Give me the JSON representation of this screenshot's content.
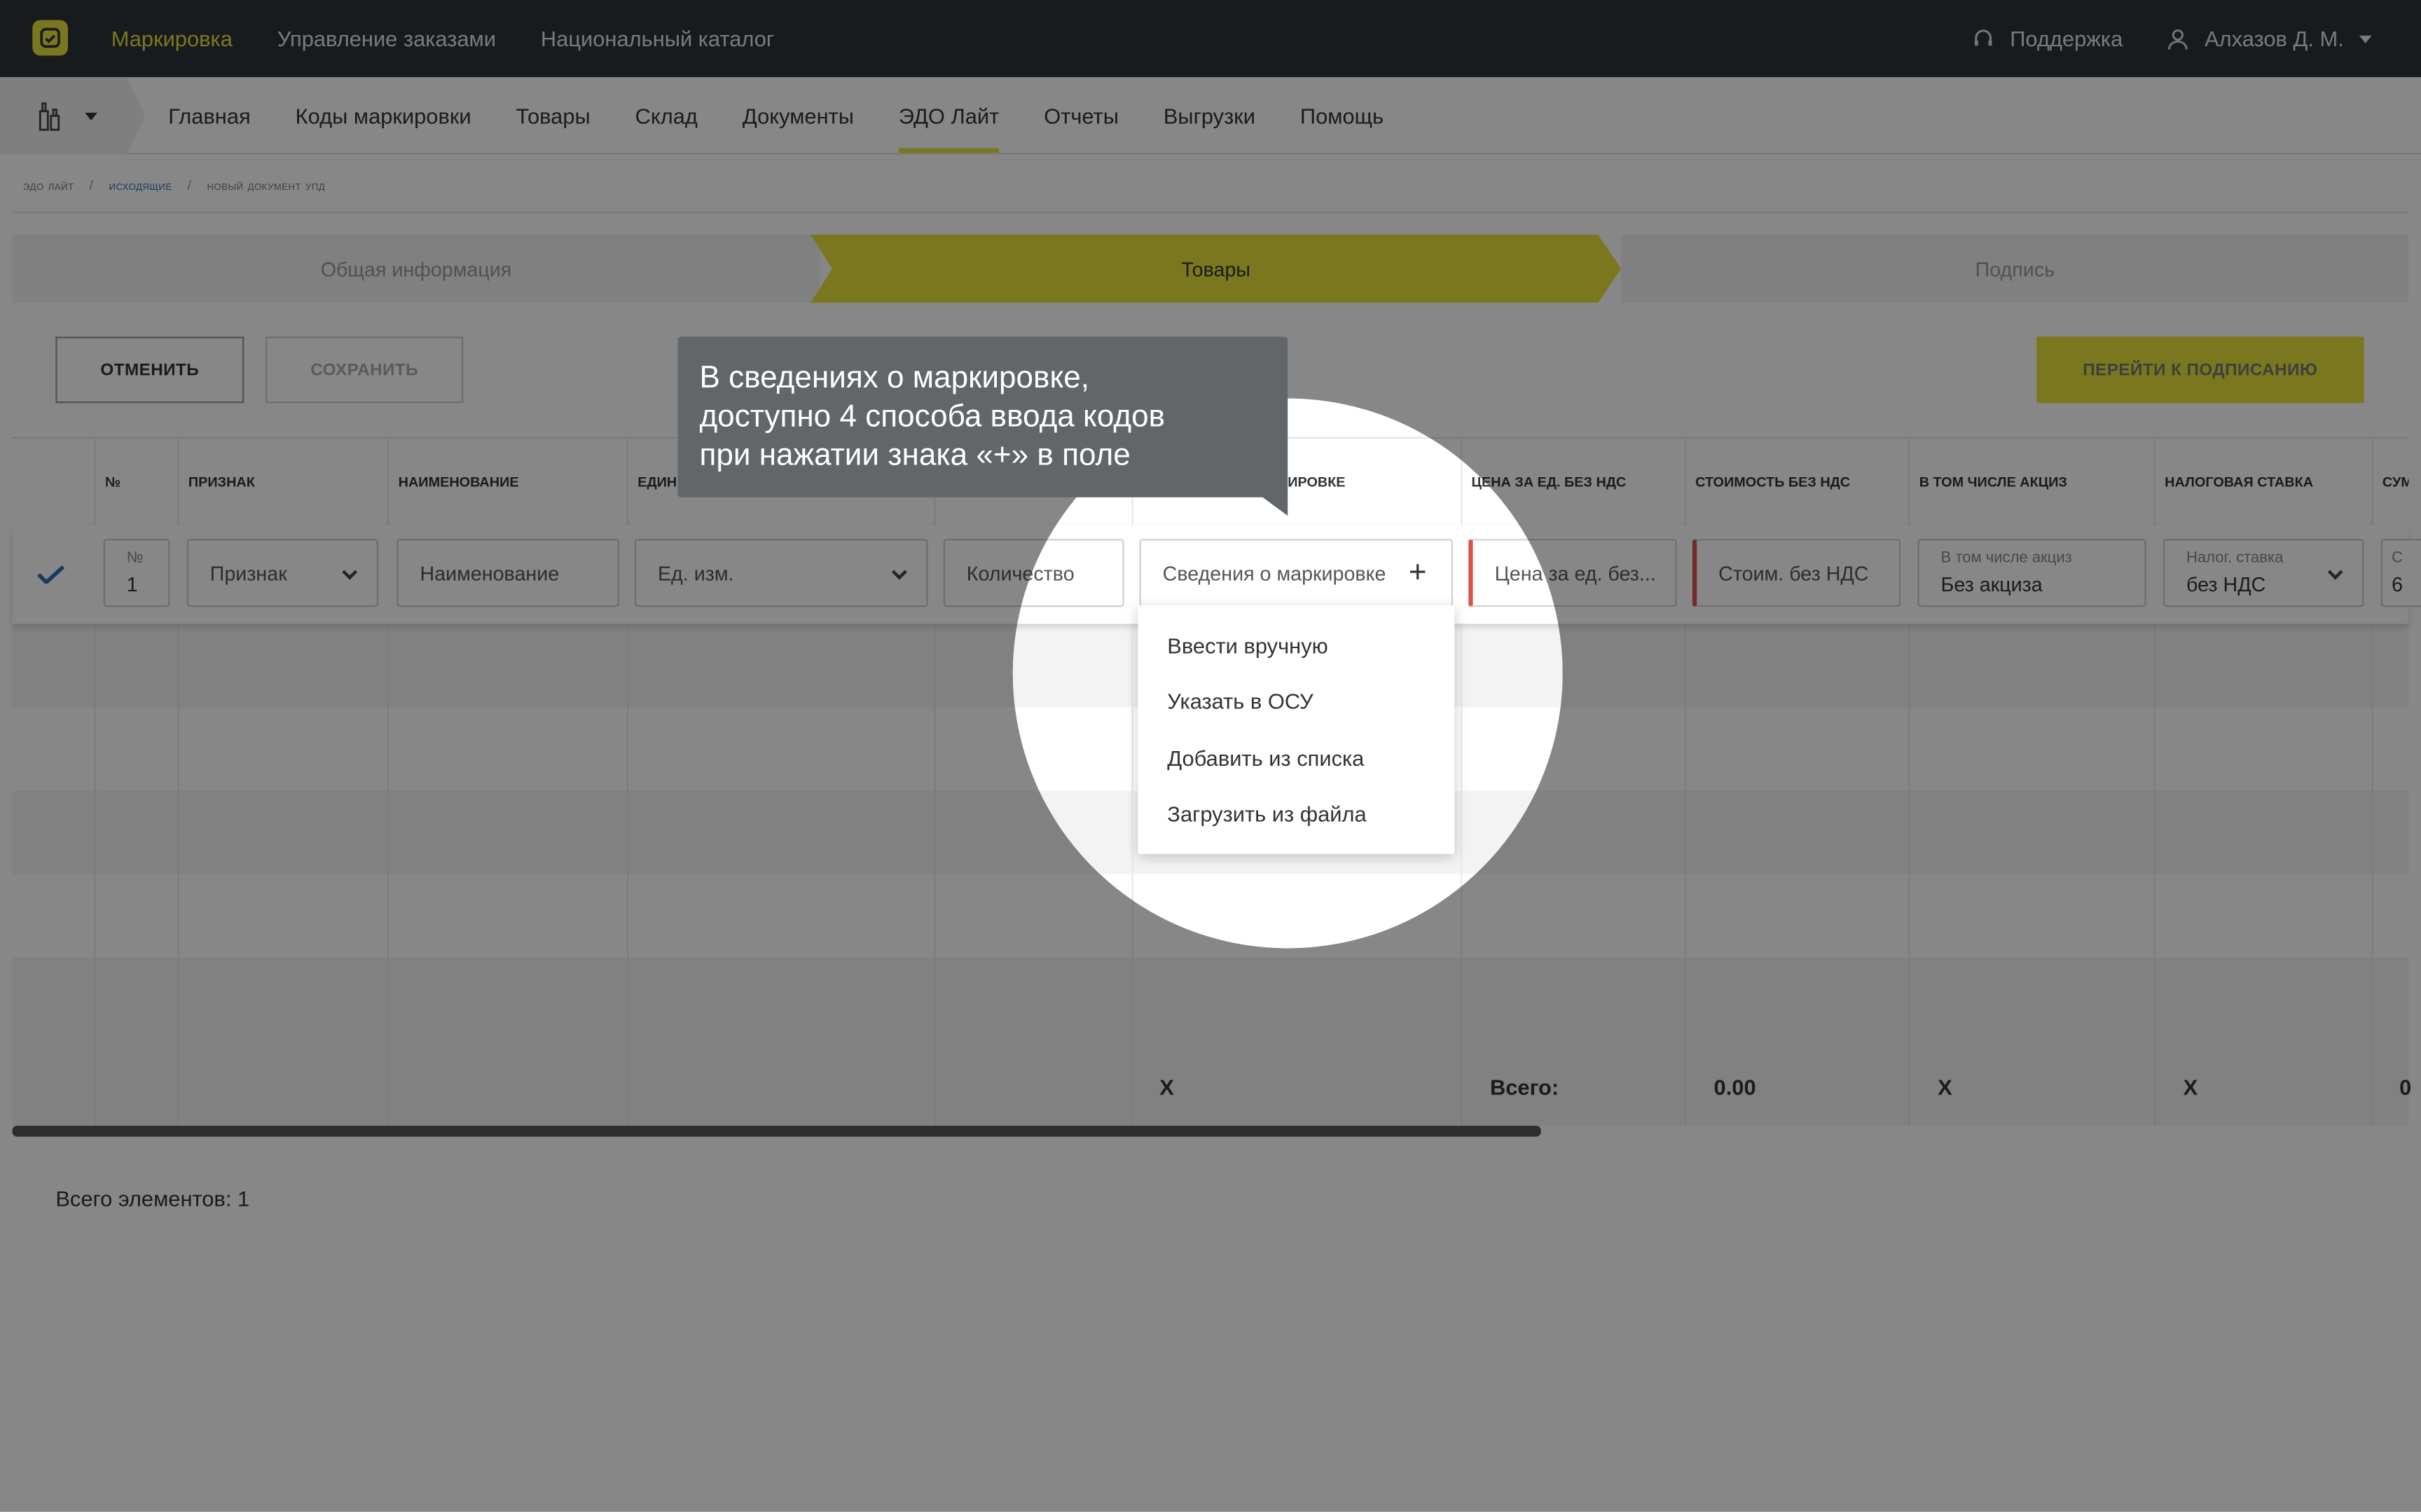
{
  "topbar": {
    "nav": [
      "Маркировка",
      "Управление заказами",
      "Национальный каталог"
    ],
    "support": "Поддержка",
    "user": "Алхазов Д. М."
  },
  "subnav": {
    "items": [
      "Главная",
      "Коды маркировки",
      "Товары",
      "Склад",
      "Документы",
      "ЭДО Лайт",
      "Отчеты",
      "Выгрузки",
      "Помощь"
    ],
    "active": "ЭДО Лайт"
  },
  "breadcrumb": {
    "items": [
      "эдо лайт",
      "исходящие",
      "новый документ упд"
    ],
    "separator": "/"
  },
  "steps": [
    "Общая информация",
    "Товары",
    "Подпись"
  ],
  "actions": {
    "cancel": "ОТМЕНИТЬ",
    "save": "СОХРАНИТЬ",
    "sign": "ПЕРЕЙТИ К ПОДПИСАНИЮ"
  },
  "table": {
    "headers": [
      "№",
      "ПРИЗНАК",
      "НАИМЕНОВАНИЕ",
      "ЕДИН",
      "",
      "ИРОВКЕ",
      "ЦЕНА ЗА ЕД. БЕЗ НДС",
      "СТОИМОСТЬ БЕЗ НДС",
      "В ТОМ ЧИСЛЕ АКЦИЗ",
      "НАЛОГОВАЯ СТАВКА",
      "СУМ"
    ],
    "row": {
      "num_label": "№",
      "num_value": "1",
      "sign_placeholder": "Признак",
      "name_placeholder": "Наименование",
      "unit_placeholder": "Ед. изм.",
      "qty_placeholder": "Количество",
      "marking_placeholder": "Сведения о маркировке",
      "marking_add": "+",
      "price_placeholder": "Цена за ед. без...",
      "cost_placeholder": "Стоим. без НДС",
      "excise_label": "В том числе акциз",
      "excise_value": "Без акциза",
      "tax_label": "Налог. ставка",
      "tax_value": "без НДС",
      "sum_label": "С",
      "sum_value": "6"
    },
    "totals": {
      "marking": "X",
      "label": "Всего:",
      "cost": "0.00",
      "excise": "X",
      "tax": "X",
      "sum": "0"
    }
  },
  "marking_menu": [
    "Ввести вручную",
    "Указать в ОСУ",
    "Добавить из списка",
    "Загрузить из файла"
  ],
  "tooltip": {
    "line1": "В сведениях о маркировке,",
    "line2": "доступно 4 способа ввода кодов",
    "line3": "при нажатии знака «+» в поле"
  },
  "footer": {
    "total_elements": "Всего элементов: 1"
  },
  "colors": {
    "accent": "#e8e03a",
    "topbar": "#2f3439",
    "link": "#2c6fb8",
    "error": "#d9534f"
  }
}
